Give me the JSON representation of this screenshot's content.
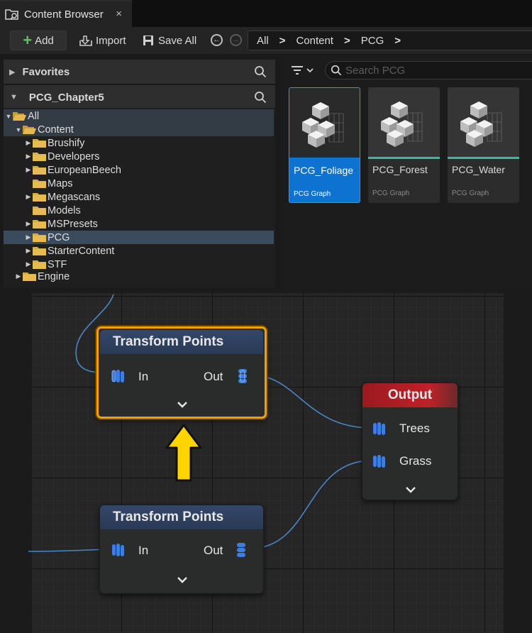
{
  "tab": {
    "title": "Content Browser",
    "close": "×"
  },
  "toolbar": {
    "add": "Add",
    "import": "Import",
    "save_all": "Save All"
  },
  "breadcrumb": [
    "All",
    "Content",
    "PCG"
  ],
  "favorites": {
    "label": "Favorites"
  },
  "project": {
    "label": "PCG_Chapter5"
  },
  "tree": [
    {
      "label": "All"
    },
    {
      "label": "Content"
    },
    {
      "label": "Brushify"
    },
    {
      "label": "Developers"
    },
    {
      "label": "EuropeanBeech"
    },
    {
      "label": "Maps"
    },
    {
      "label": "Megascans"
    },
    {
      "label": "Models"
    },
    {
      "label": "MSPresets"
    },
    {
      "label": "PCG"
    },
    {
      "label": "StarterContent"
    },
    {
      "label": "STF"
    },
    {
      "label": "Engine"
    }
  ],
  "search": {
    "placeholder": "Search PCG"
  },
  "assets": [
    {
      "name": "PCG_Foliage",
      "type": "PCG Graph"
    },
    {
      "name": "PCG_Forest",
      "type": "PCG Graph"
    },
    {
      "name": "PCG_Water",
      "type": "PCG Graph"
    }
  ],
  "colors": {
    "selection": "#0e72d0",
    "node_highlight": "#f2a000",
    "output_header": "#c02128",
    "wire": "#4a86c8",
    "arrow": "#ffd400"
  },
  "graph": {
    "node1": {
      "title": "Transform Points",
      "in": "In",
      "out": "Out"
    },
    "node2": {
      "title": "Transform Points",
      "in": "In",
      "out": "Out"
    },
    "output": {
      "title": "Output",
      "pin1": "Trees",
      "pin2": "Grass"
    }
  }
}
